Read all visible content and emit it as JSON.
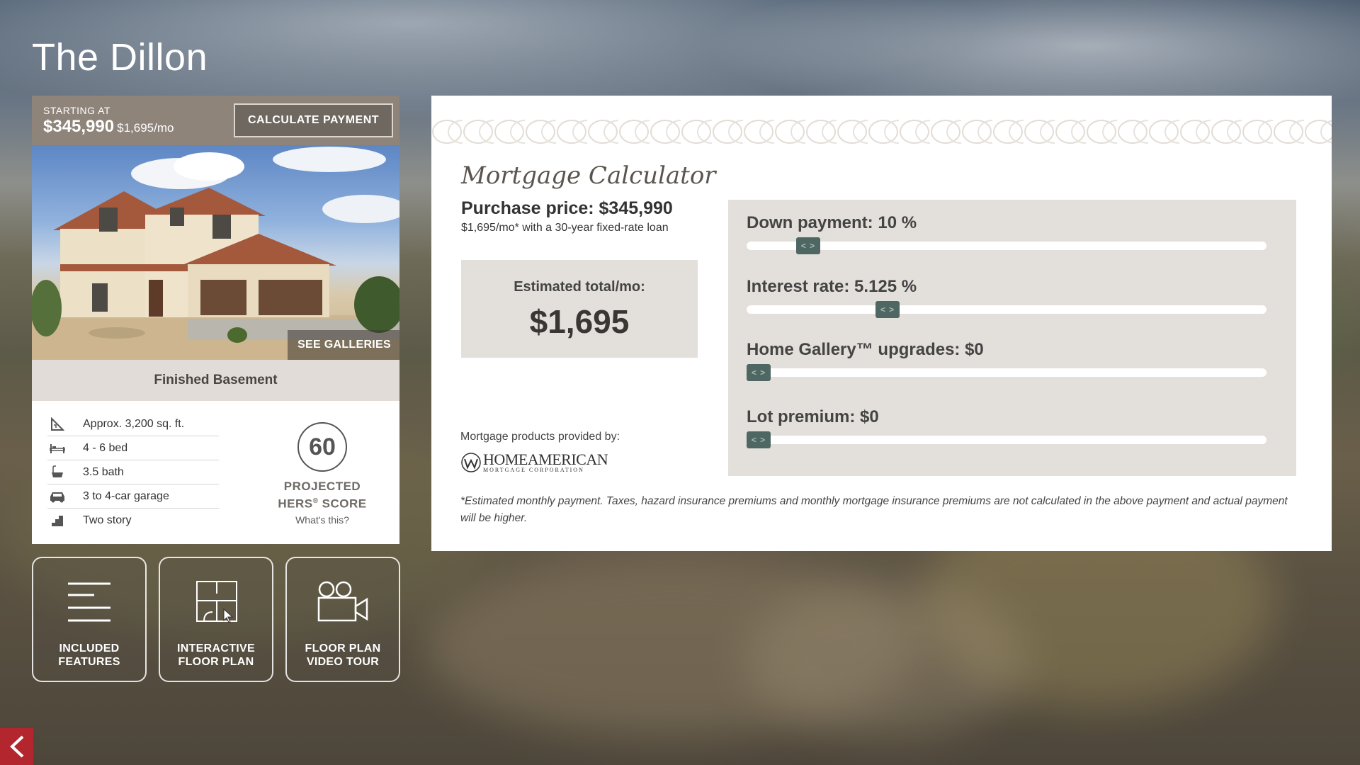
{
  "page": {
    "title": "The Dillon"
  },
  "card": {
    "starting_label": "STARTING AT",
    "price": "$345,990",
    "price_monthly": "$1,695/mo",
    "calc_button": "CALCULATE PAYMENT",
    "see_galleries": "SEE GALLERIES",
    "option_label": "Finished Basement",
    "specs": [
      {
        "icon": "square-footage-icon",
        "text": "Approx. 3,200 sq. ft."
      },
      {
        "icon": "bed-icon",
        "text": "4 - 6 bed"
      },
      {
        "icon": "bathtub-icon",
        "text": "3.5 bath"
      },
      {
        "icon": "car-icon",
        "text": "3 to 4-car garage"
      },
      {
        "icon": "stairs-icon",
        "text": "Two story"
      }
    ],
    "hers_score": "60",
    "hers_label_1": "PROJECTED",
    "hers_label_2": "HERS",
    "hers_label_reg": "®",
    "hers_label_3": " SCORE",
    "hers_link": "What's this?"
  },
  "tiles": [
    {
      "icon": "list-icon",
      "label": "INCLUDED\nFEATURES"
    },
    {
      "icon": "floor-plan-icon",
      "label": "INTERACTIVE\nFLOOR PLAN"
    },
    {
      "icon": "video-camera-icon",
      "label": "FLOOR PLAN\nVIDEO TOUR"
    }
  ],
  "calculator": {
    "title": "Mortgage Calculator",
    "purchase_price": "Purchase price: $345,990",
    "purchase_sub": "$1,695/mo* with a 30-year fixed-rate loan",
    "estimated_label": "Estimated total/mo:",
    "estimated_value": "$1,695",
    "provided_by": "Mortgage products provided by:",
    "logo_text": "HOMEAMERICAN",
    "logo_sub": "MORTGAGE CORPORATION",
    "disclaimer": "*Estimated monthly payment. Taxes, hazard insurance premiums and monthly mortgage insurance premiums are not calculated in the above payment and actual payment will be higher.",
    "sliders": [
      {
        "label": "Down payment:  10 %",
        "position": 0.1,
        "thumb": "< >"
      },
      {
        "label": "Interest rate:  5.125 %",
        "position": 0.26,
        "thumb": "< >"
      },
      {
        "label": "Home Gallery™ upgrades:  $0",
        "position": 0.0,
        "thumb": "< >"
      },
      {
        "label": "Lot premium:  $0",
        "position": 0.0,
        "thumb": "< >"
      }
    ]
  },
  "colors": {
    "accent": "#b3262e",
    "price_bar": "#8e847a",
    "slider_thumb": "#4f6762",
    "panel_gray": "#e3dfdb"
  }
}
